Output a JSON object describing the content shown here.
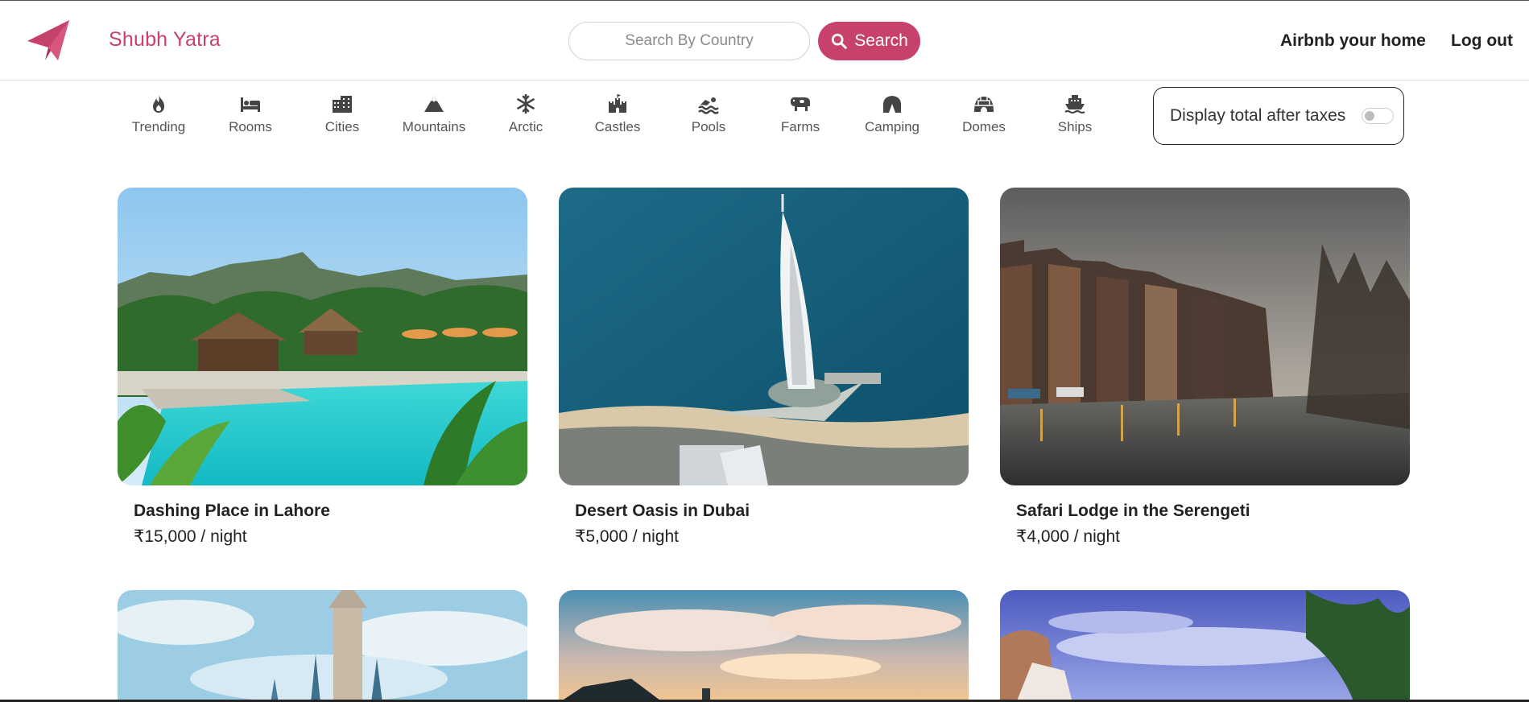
{
  "navbar": {
    "brand": "Shubh Yatra",
    "search_placeholder": "Search By Country",
    "search_button": "Search",
    "links": {
      "host": "Airbnb your home",
      "logout": "Log out"
    }
  },
  "filters": [
    {
      "label": "Trending",
      "icon": "fire-icon"
    },
    {
      "label": "Rooms",
      "icon": "bed-icon"
    },
    {
      "label": "Cities",
      "icon": "city-icon"
    },
    {
      "label": "Mountains",
      "icon": "mountain-icon"
    },
    {
      "label": "Arctic",
      "icon": "snowflake-icon"
    },
    {
      "label": "Castles",
      "icon": "castle-icon"
    },
    {
      "label": "Pools",
      "icon": "swimmer-icon"
    },
    {
      "label": "Farms",
      "icon": "cow-icon"
    },
    {
      "label": "Camping",
      "icon": "tent-icon"
    },
    {
      "label": "Domes",
      "icon": "igloo-icon"
    },
    {
      "label": "Ships",
      "icon": "ship-icon"
    }
  ],
  "tax_toggle": {
    "label": "Display total after taxes",
    "enabled": false
  },
  "listings": [
    {
      "title": "Dashing Place in Lahore",
      "price": "₹15,000 / night"
    },
    {
      "title": "Desert Oasis in Dubai",
      "price": "₹5,000 / night"
    },
    {
      "title": "Safari Lodge in the Serengeti",
      "price": "₹4,000 / night"
    },
    {
      "title": "",
      "price": ""
    },
    {
      "title": "",
      "price": ""
    },
    {
      "title": "",
      "price": ""
    }
  ],
  "colors": {
    "brand": "#c7426a",
    "text": "#222222",
    "muted": "#555555"
  }
}
